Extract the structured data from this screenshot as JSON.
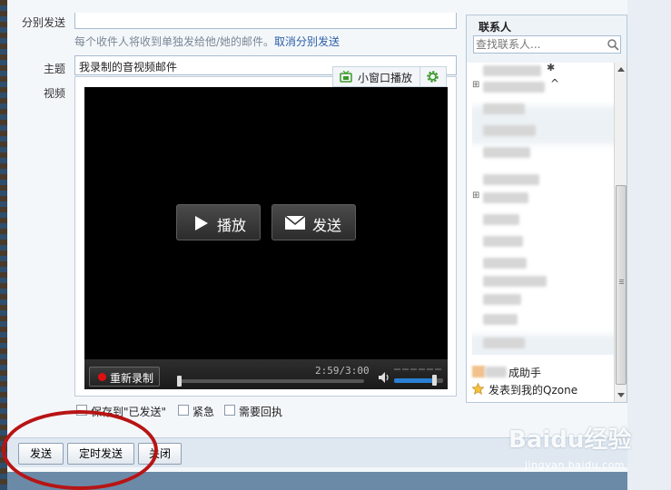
{
  "compose": {
    "separate_send_label": "分别发送",
    "separate_hint": "每个收件人将收到单独发给他/她的邮件。",
    "cancel_separate_link": "取消分别发送",
    "subject_label": "主题",
    "subject_value": "我录制的音视频邮件",
    "video_label": "视频"
  },
  "video": {
    "mini_window_label": "小窗口播放",
    "play_label": "播放",
    "send_label": "发送",
    "rerecord_label": "重新录制",
    "time_display": "2:59/3:00",
    "progress": 0.0,
    "volume": 0.85
  },
  "options": {
    "save_sent_label": "保存到\"已发送\"",
    "urgent_label": "紧急",
    "receipt_label": "需要回执"
  },
  "footer": {
    "send_label": "发送",
    "scheduled_send_label": "定时发送",
    "close_label": "关闭"
  },
  "contacts": {
    "title": "联系人",
    "search_placeholder": "查找联系人...",
    "footer_items": [
      "文件中转助手",
      "发表到我的Qzone"
    ],
    "footer_visible_text": [
      "成助手",
      "发表到我的Qzone"
    ]
  },
  "watermark": {
    "main": "Baidu经验",
    "sub": "jingyan.baidu.com"
  },
  "colors": {
    "link": "#2b5fa8",
    "annotation_circle": "#b81414",
    "video_bg": "#000000",
    "record_dot": "#e01010",
    "volume_fill": "#2a7fd4",
    "icon_green": "#3a9a2a"
  },
  "icons": [
    "tv-icon",
    "gear-icon",
    "play-icon",
    "envelope-icon",
    "record-dot-icon",
    "volume-icon",
    "search-icon",
    "qzone-star-icon"
  ]
}
